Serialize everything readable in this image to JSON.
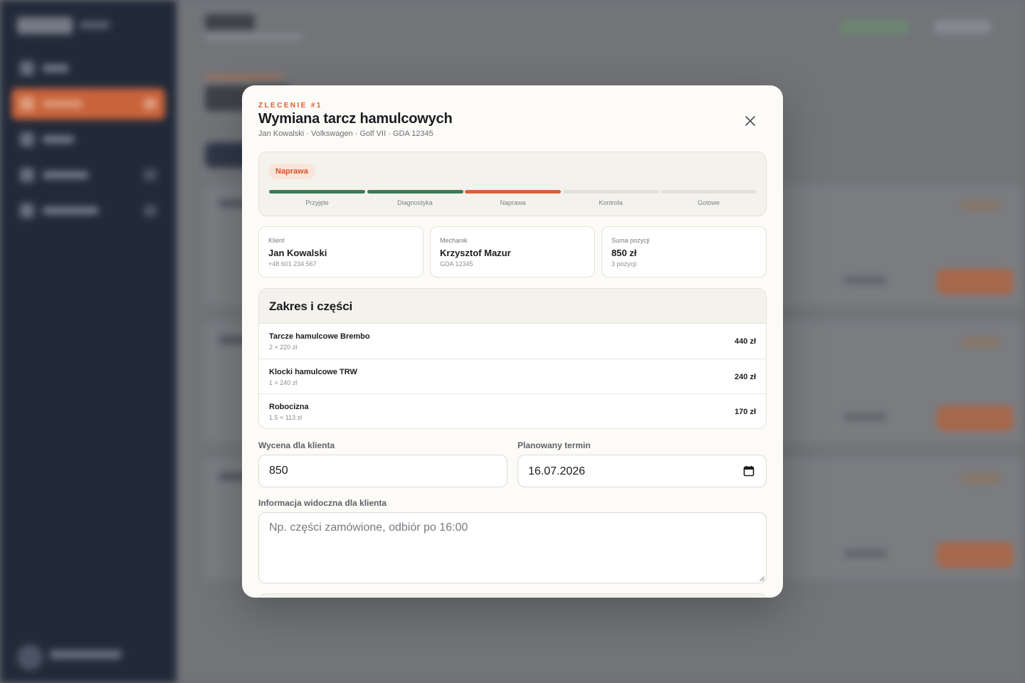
{
  "modal": {
    "eyebrow": "ZLECENIE #1",
    "title": "Wymiana tarcz hamulcowych",
    "subtitle": "Jan Kowalski · Volkswagen · Golf VII · GDA 12345",
    "close_icon": "close-icon"
  },
  "status": {
    "badge": "Naprawa",
    "steps": [
      {
        "label": "Przyjęte",
        "state": "done"
      },
      {
        "label": "Diagnostyka",
        "state": "done"
      },
      {
        "label": "Naprawa",
        "state": "current"
      },
      {
        "label": "Kontrola",
        "state": "pending"
      },
      {
        "label": "Gotowe",
        "state": "pending"
      }
    ]
  },
  "info": {
    "client": {
      "label": "Klient",
      "value": "Jan Kowalski",
      "sub": "+48 601 234 567"
    },
    "mechanic": {
      "label": "Mechanik",
      "value": "Krzysztof Mazur",
      "sub": "GDA 12345"
    },
    "total": {
      "label": "Suma pozycji",
      "value": "850 zł",
      "sub": "3 pozycji"
    }
  },
  "parts": {
    "title": "Zakres i części",
    "items": [
      {
        "name": "Tarcze hamulcowe Brembo",
        "qty": "2 × 220 zł",
        "price": "440 zł"
      },
      {
        "name": "Klocki hamulcowe TRW",
        "qty": "1 × 240 zł",
        "price": "240 zł"
      },
      {
        "name": "Robocizna",
        "qty": "1.5 × 113 zł",
        "price": "170 zł"
      }
    ]
  },
  "form": {
    "quote_label": "Wycena dla klienta",
    "quote_value": "850",
    "date_label": "Planowany termin",
    "date_value": "16.07.2026",
    "note_label": "Informacja widoczna dla klienta",
    "note_placeholder": "Np. części zamówione, odbiór po 16:00"
  },
  "colors": {
    "accent": "#dc5d2c",
    "done": "#3d7a57",
    "sidebar": "#1b2434"
  }
}
